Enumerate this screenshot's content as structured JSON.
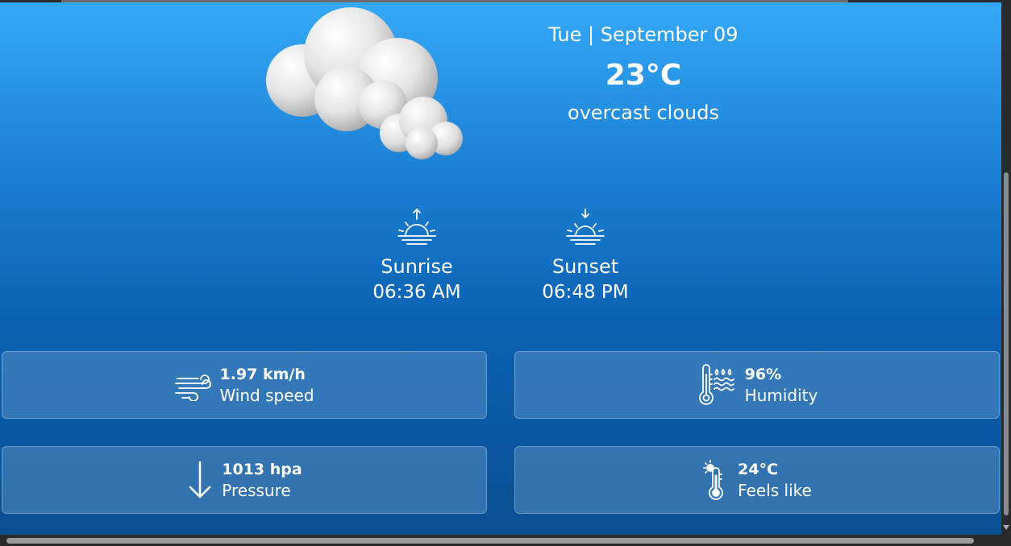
{
  "weather": {
    "date": "Tue | September 09",
    "temperature": "23°C",
    "description": "overcast clouds",
    "icon": "overcast-clouds-icon"
  },
  "sun": {
    "sunrise": {
      "label": "Sunrise",
      "time": "06:36 AM",
      "icon": "sunrise-icon"
    },
    "sunset": {
      "label": "Sunset",
      "time": "06:48 PM",
      "icon": "sunset-icon"
    }
  },
  "details": {
    "wind": {
      "value": "1.97 km/h",
      "label": "Wind speed",
      "icon": "wind-icon"
    },
    "humidity": {
      "value": "96%",
      "label": "Humidity",
      "icon": "humidity-thermometer-icon"
    },
    "pressure": {
      "value": "1013 hpa",
      "label": "Pressure",
      "icon": "arrow-down-icon"
    },
    "feels_like": {
      "value": "24°C",
      "label": "Feels like",
      "icon": "thermometer-sun-icon"
    }
  },
  "colors": {
    "background_top": "#35a9f7",
    "background_bottom": "#0a4f92",
    "card": "#6ea0cd",
    "text": "#ffffff"
  }
}
